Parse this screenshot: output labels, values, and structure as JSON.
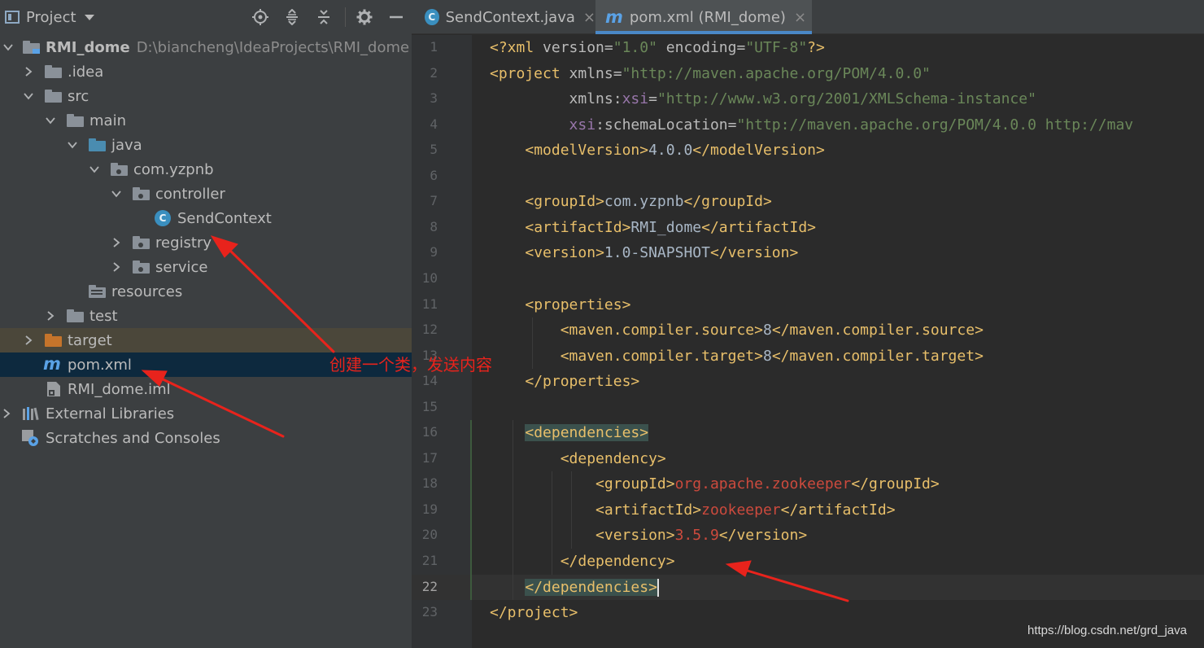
{
  "project_panel": {
    "title": "Project",
    "toolbar_icons": [
      "locate-icon",
      "expand-all-icon",
      "collapse-all-icon",
      "gear-icon",
      "hide-icon"
    ],
    "tree": [
      {
        "label": "RMI_dome",
        "hint": "D:\\biancheng\\IdeaProjects\\RMI_dome",
        "icon": "module-folder-icon",
        "expanded": true
      },
      {
        "label": ".idea",
        "icon": "folder-icon",
        "expanded": false
      },
      {
        "label": "src",
        "icon": "folder-icon",
        "expanded": true
      },
      {
        "label": "main",
        "icon": "folder-icon",
        "expanded": true
      },
      {
        "label": "java",
        "icon": "source-folder-icon",
        "expanded": true
      },
      {
        "label": "com.yzpnb",
        "icon": "package-icon",
        "expanded": true
      },
      {
        "label": "controller",
        "icon": "package-icon",
        "expanded": true
      },
      {
        "label": "SendContext",
        "icon": "java-class-icon"
      },
      {
        "label": "registry",
        "icon": "package-icon",
        "expanded": false
      },
      {
        "label": "service",
        "icon": "package-icon",
        "expanded": false
      },
      {
        "label": "resources",
        "icon": "resources-folder-icon"
      },
      {
        "label": "test",
        "icon": "folder-icon",
        "expanded": false
      },
      {
        "label": "target",
        "icon": "excluded-folder-icon",
        "expanded": false
      },
      {
        "label": "pom.xml",
        "icon": "maven-icon"
      },
      {
        "label": "RMI_dome.iml",
        "icon": "iml-file-icon"
      },
      {
        "label": "External Libraries",
        "icon": "libraries-icon",
        "expanded": false
      },
      {
        "label": "Scratches and Consoles",
        "icon": "scratches-icon"
      }
    ]
  },
  "editor": {
    "tabs": [
      {
        "label": "SendContext.java",
        "icon": "java-class-icon",
        "active": false
      },
      {
        "label": "pom.xml (RMI_dome)",
        "icon": "maven-icon",
        "active": true
      }
    ],
    "current_line": 22,
    "lines": [
      "<?xml version=\"1.0\" encoding=\"UTF-8\"?>",
      "<project xmlns=\"http://maven.apache.org/POM/4.0.0\"",
      "         xmlns:xsi=\"http://www.w3.org/2001/XMLSchema-instance\"",
      "         xsi:schemaLocation=\"http://maven.apache.org/POM/4.0.0 http://mav",
      "    <modelVersion>4.0.0</modelVersion>",
      "",
      "    <groupId>com.yzpnb</groupId>",
      "    <artifactId>RMI_dome</artifactId>",
      "    <version>1.0-SNAPSHOT</version>",
      "",
      "    <properties>",
      "        <maven.compiler.source>8</maven.compiler.source>",
      "        <maven.compiler.target>8</maven.compiler.target>",
      "    </properties>",
      "",
      "    <dependencies>",
      "        <dependency>",
      "            <groupId>org.apache.zookeeper</groupId>",
      "            <artifactId>zookeeper</artifactId>",
      "            <version>3.5.9</version>",
      "        </dependency>",
      "    </dependencies>",
      "</project>"
    ]
  },
  "annotation": {
    "text": "创建一个类，发送内容",
    "color": "#e8231c"
  },
  "watermark": "https://blog.csdn.net/grd_java",
  "colors": {
    "panel_bg": "#3c3f41",
    "editor_bg": "#2b2b2b",
    "selection": "#0d293e",
    "tag": "#e8bf6a",
    "string": "#6a8759",
    "dependency_value": "#cc4a3d"
  }
}
